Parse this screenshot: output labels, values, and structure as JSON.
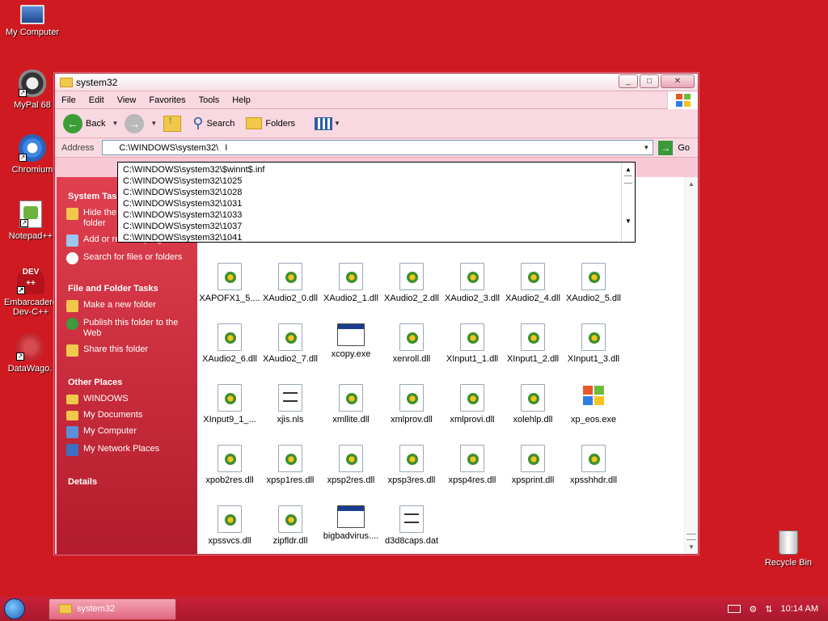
{
  "desktop": {
    "icons": [
      {
        "label": "My Computer",
        "icon": "computer-icon"
      },
      {
        "label": "MyPal 68",
        "icon": "mypal-icon"
      },
      {
        "label": "Chromium",
        "icon": "chromium-icon"
      },
      {
        "label": "Notepad++",
        "icon": "notepadpp-icon"
      },
      {
        "label": "Embarcadero Dev-C++",
        "icon": "devcpp-icon"
      },
      {
        "label": "DataWago.",
        "icon": "datawago-icon"
      },
      {
        "label": "Recycle Bin",
        "icon": "recycle-bin-icon"
      }
    ],
    "colors": {
      "background": "#d01a22",
      "window_tint": "#f7c9d5"
    }
  },
  "window": {
    "title": "system32",
    "buttons": {
      "minimize": "_",
      "maximize": "□",
      "close": "✕"
    }
  },
  "menu": [
    "File",
    "Edit",
    "View",
    "Favorites",
    "Tools",
    "Help"
  ],
  "toolbar": {
    "back": "Back",
    "search": "Search",
    "folders": "Folders"
  },
  "address": {
    "label": "Address",
    "value": "C:\\WINDOWS\\system32\\",
    "go": "Go",
    "suggestions": [
      "C:\\WINDOWS\\system32\\$winnt$.inf",
      "C:\\WINDOWS\\system32\\1025",
      "C:\\WINDOWS\\system32\\1028",
      "C:\\WINDOWS\\system32\\1031",
      "C:\\WINDOWS\\system32\\1033",
      "C:\\WINDOWS\\system32\\1037",
      "C:\\WINDOWS\\system32\\1041"
    ]
  },
  "sidebar": {
    "system_tasks": {
      "heading": "System Tasks",
      "items": [
        "Hide the contents of this folder",
        "Add or remove programs",
        "Search for files or folders"
      ]
    },
    "file_tasks": {
      "heading": "File and Folder Tasks",
      "items": [
        "Make a new folder",
        "Publish this folder to the Web",
        "Share this folder"
      ]
    },
    "other_places": {
      "heading": "Other Places",
      "items": [
        "WINDOWS",
        "My Documents",
        "My Computer",
        "My Network Places"
      ]
    },
    "details": {
      "heading": "Details"
    }
  },
  "files": [
    {
      "name": "XAPOFX1_5....",
      "type": "dll"
    },
    {
      "name": "XAudio2_0.dll",
      "type": "dll"
    },
    {
      "name": "XAudio2_1.dll",
      "type": "dll"
    },
    {
      "name": "XAudio2_2.dll",
      "type": "dll"
    },
    {
      "name": "XAudio2_3.dll",
      "type": "dll"
    },
    {
      "name": "XAudio2_4.dll",
      "type": "dll"
    },
    {
      "name": "XAudio2_5.dll",
      "type": "dll"
    },
    {
      "name": "XAudio2_6.dll",
      "type": "dll"
    },
    {
      "name": "XAudio2_7.dll",
      "type": "dll"
    },
    {
      "name": "xcopy.exe",
      "type": "exe"
    },
    {
      "name": "xenroll.dll",
      "type": "dll"
    },
    {
      "name": "XInput1_1.dll",
      "type": "dll"
    },
    {
      "name": "XInput1_2.dll",
      "type": "dll"
    },
    {
      "name": "XInput1_3.dll",
      "type": "dll"
    },
    {
      "name": "XInput9_1_...",
      "type": "dll"
    },
    {
      "name": "xjis.nls",
      "type": "doc"
    },
    {
      "name": "xmllite.dll",
      "type": "dll"
    },
    {
      "name": "xmlprov.dll",
      "type": "dll"
    },
    {
      "name": "xmlprovi.dll",
      "type": "dll"
    },
    {
      "name": "xolehlp.dll",
      "type": "dll"
    },
    {
      "name": "xp_eos.exe",
      "type": "win"
    },
    {
      "name": "xpob2res.dll",
      "type": "dll"
    },
    {
      "name": "xpsp1res.dll",
      "type": "dll"
    },
    {
      "name": "xpsp2res.dll",
      "type": "dll"
    },
    {
      "name": "xpsp3res.dll",
      "type": "dll"
    },
    {
      "name": "xpsp4res.dll",
      "type": "dll"
    },
    {
      "name": "xpsprint.dll",
      "type": "dll"
    },
    {
      "name": "xpsshhdr.dll",
      "type": "dll"
    },
    {
      "name": "xpssvcs.dll",
      "type": "dll"
    },
    {
      "name": "zipfldr.dll",
      "type": "dll"
    },
    {
      "name": "bigbadvirus....",
      "type": "exe"
    },
    {
      "name": "d3d8caps.dat",
      "type": "doc"
    }
  ],
  "taskbar": {
    "task": "system32",
    "clock": "10:14 AM"
  }
}
